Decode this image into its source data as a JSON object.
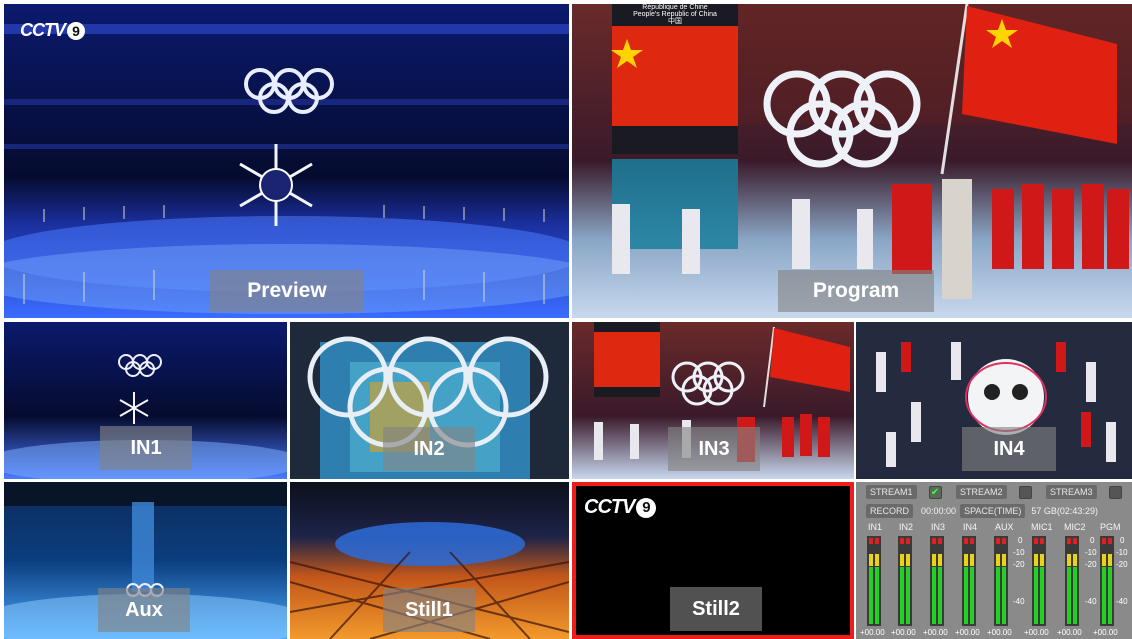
{
  "logo": {
    "text": "CCTV",
    "number": "9"
  },
  "tiles": {
    "preview": "Preview",
    "program": "Program",
    "in1": "IN1",
    "in2": "IN2",
    "in3": "IN3",
    "in4": "IN4",
    "aux": "Aux",
    "still1": "Still1",
    "still2": "Still2"
  },
  "program_banner": {
    "line1": "République de Chine",
    "line2": "People's Republic of China",
    "line3": "中国"
  },
  "audio_panel": {
    "stream1": "STREAM1",
    "stream1_checked": true,
    "stream2": "STREAM2",
    "stream2_checked": false,
    "stream3": "STREAM3",
    "stream3_checked": false,
    "record": "RECORD",
    "record_time": "00:00:00",
    "space_label": "SPACE(TIME)",
    "space_value": "57 GB(02:43:29)",
    "channels": [
      {
        "name": "IN1",
        "value": "+00.00"
      },
      {
        "name": "IN2",
        "value": "+00.00"
      },
      {
        "name": "IN3",
        "value": "+00.00"
      },
      {
        "name": "IN4",
        "value": "+00.00"
      },
      {
        "name": "AUX",
        "value": "+00.00"
      },
      {
        "name": "MIC1",
        "value": "+00.00"
      },
      {
        "name": "MIC2",
        "value": "+00.00"
      },
      {
        "name": "PGM",
        "value": "+00.00"
      }
    ],
    "scale": [
      "0",
      "-10",
      "-20",
      "-40"
    ],
    "colors": {
      "green": "#25d025",
      "yellow": "#e8d21a",
      "red": "#e02020",
      "selected_input": "#22d322",
      "program_input": "#ef1c1c"
    }
  }
}
